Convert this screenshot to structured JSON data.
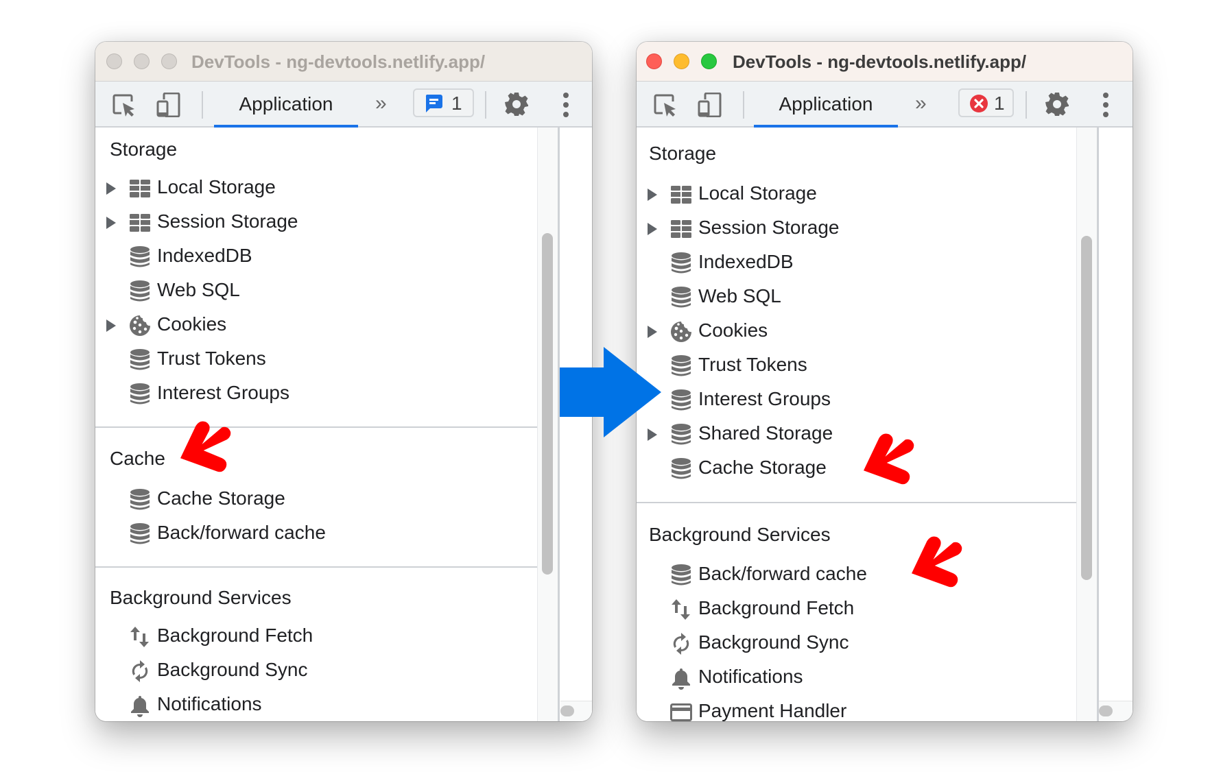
{
  "left_window": {
    "title": "DevTools - ng-devtools.netlify.app/",
    "window_state": "inactive",
    "toolbar": {
      "active_tab": "Application",
      "more_tabs_label": "»",
      "badge": {
        "icon": "message-icon",
        "count": "1",
        "color": "#1a73e8"
      }
    },
    "sections": [
      {
        "title": "Storage",
        "items": [
          {
            "label": "Local Storage",
            "icon": "table-icon",
            "expandable": true
          },
          {
            "label": "Session Storage",
            "icon": "table-icon",
            "expandable": true
          },
          {
            "label": "IndexedDB",
            "icon": "database-icon",
            "expandable": false
          },
          {
            "label": "Web SQL",
            "icon": "database-icon",
            "expandable": false
          },
          {
            "label": "Cookies",
            "icon": "cookie-icon",
            "expandable": true
          },
          {
            "label": "Trust Tokens",
            "icon": "database-icon",
            "expandable": false
          },
          {
            "label": "Interest Groups",
            "icon": "database-icon",
            "expandable": false
          }
        ]
      },
      {
        "title": "Cache",
        "items": [
          {
            "label": "Cache Storage",
            "icon": "database-icon",
            "expandable": false
          },
          {
            "label": "Back/forward cache",
            "icon": "database-icon",
            "expandable": false
          }
        ]
      },
      {
        "title": "Background Services",
        "items": [
          {
            "label": "Background Fetch",
            "icon": "up-down-arrows-icon",
            "expandable": false
          },
          {
            "label": "Background Sync",
            "icon": "sync-icon",
            "expandable": false
          },
          {
            "label": "Notifications",
            "icon": "bell-icon",
            "expandable": false
          }
        ]
      }
    ]
  },
  "right_window": {
    "title": "DevTools - ng-devtools.netlify.app/",
    "window_state": "active",
    "toolbar": {
      "active_tab": "Application",
      "more_tabs_label": "»",
      "badge": {
        "icon": "error-icon",
        "count": "1",
        "color": "#e8363f"
      }
    },
    "sections": [
      {
        "title": "Storage",
        "items": [
          {
            "label": "Local Storage",
            "icon": "table-icon",
            "expandable": true
          },
          {
            "label": "Session Storage",
            "icon": "table-icon",
            "expandable": true
          },
          {
            "label": "IndexedDB",
            "icon": "database-icon",
            "expandable": false
          },
          {
            "label": "Web SQL",
            "icon": "database-icon",
            "expandable": false
          },
          {
            "label": "Cookies",
            "icon": "cookie-icon",
            "expandable": true
          },
          {
            "label": "Trust Tokens",
            "icon": "database-icon",
            "expandable": false
          },
          {
            "label": "Interest Groups",
            "icon": "database-icon",
            "expandable": false
          },
          {
            "label": "Shared Storage",
            "icon": "database-icon",
            "expandable": true
          },
          {
            "label": "Cache Storage",
            "icon": "database-icon",
            "expandable": false
          }
        ]
      },
      {
        "title": "Background Services",
        "items": [
          {
            "label": "Back/forward cache",
            "icon": "database-icon",
            "expandable": false
          },
          {
            "label": "Background Fetch",
            "icon": "up-down-arrows-icon",
            "expandable": false
          },
          {
            "label": "Background Sync",
            "icon": "sync-icon",
            "expandable": false
          },
          {
            "label": "Notifications",
            "icon": "bell-icon",
            "expandable": false
          },
          {
            "label": "Payment Handler",
            "icon": "credit-card-icon",
            "expandable": false
          }
        ]
      }
    ]
  },
  "annotations": {
    "transition_arrow_color": "#0073e6",
    "highlight_arrow_color": "#ff0000",
    "highlighted_items": [
      "Cache (left)",
      "Cache Storage (right)",
      "Back/forward cache (right)"
    ]
  },
  "colors": {
    "tab_underline": "#1a73e8",
    "icon_gray": "#6e6e6e",
    "text": "#202124"
  }
}
